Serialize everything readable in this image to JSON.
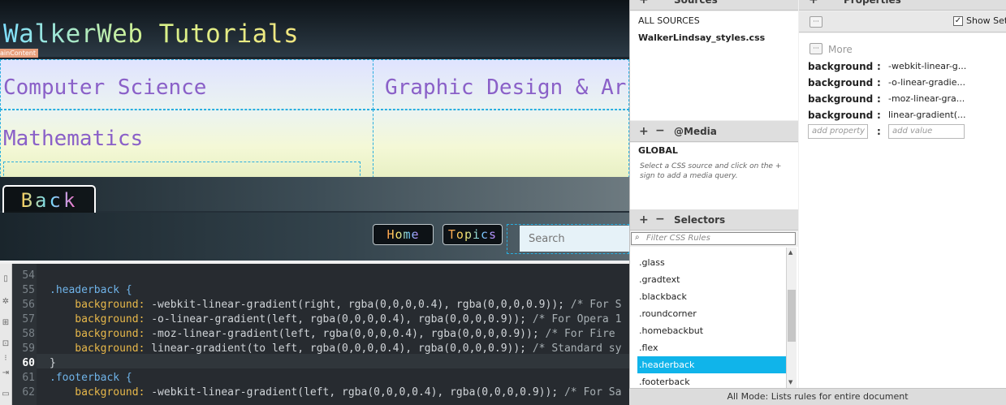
{
  "live": {
    "site_title": "WalkerWeb Tutorials",
    "main_tag": "ainContent",
    "subjects": [
      "Computer Science",
      "Graphic Design & Ar",
      "Mathematics"
    ],
    "back_label": "Back",
    "home_label": "Home",
    "topics_label": "Topics",
    "search_placeholder": "Search"
  },
  "code": {
    "line_numbers": [
      "54",
      "55",
      "56",
      "57",
      "58",
      "59",
      "60",
      "61",
      "62"
    ],
    "active_line": "60",
    "l55_selector": ".headerback {",
    "l56_prop": "    background:",
    "l56_val": " -webkit-linear-gradient(right, rgba(0,0,0,0.4), rgba(0,0,0,0.9)); ",
    "l56_cmt": "/* For S",
    "l57_prop": "    background:",
    "l57_val": " -o-linear-gradient(left, rgba(0,0,0,0.4), rgba(0,0,0,0.9)); ",
    "l57_cmt": "/* For Opera 1",
    "l58_prop": "    background:",
    "l58_val": " -moz-linear-gradient(left, rgba(0,0,0,0.4), rgba(0,0,0,0.9)); ",
    "l58_cmt": "/* For Fire",
    "l59_prop": "    background:",
    "l59_val": " linear-gradient(to left, rgba(0,0,0,0.4), rgba(0,0,0,0.9)); ",
    "l59_cmt": "/* Standard sy",
    "l60_text": "}",
    "l61_selector": ".footerback {",
    "l62_prop": "    background:",
    "l62_val": " -webkit-linear-gradient(left, rgba(0,0,0,0.4), rgba(0,0,0,0.9)); ",
    "l62_cmt": "/* For Sa"
  },
  "sources": {
    "title": "Sources",
    "all_label": "ALL SOURCES",
    "file": "WalkerLindsay_styles.css"
  },
  "media": {
    "title": "@Media",
    "global_label": "GLOBAL",
    "hint": "Select a CSS source and click on the + sign to add a media query."
  },
  "selectors": {
    "title": "Selectors",
    "filter_placeholder": "Filter CSS Rules",
    "items": [
      ".glass",
      ".gradtext",
      ".blackback",
      ".roundcorner",
      ".homebackbut",
      ".flex",
      ".headerback",
      ".footerback"
    ],
    "selected_index": 6
  },
  "properties": {
    "title": "Properties",
    "show_set_label": "Show Set",
    "more_label": "More",
    "rows": [
      {
        "name": "background",
        "value": "-webkit-linear-g..."
      },
      {
        "name": "background",
        "value": "-o-linear-gradie..."
      },
      {
        "name": "background",
        "value": "-moz-linear-gra..."
      },
      {
        "name": "background",
        "value": "linear-gradient(..."
      }
    ],
    "add_property_placeholder": "add property",
    "add_value_placeholder": "add value"
  },
  "status_bar": "All Mode: Lists rules for entire document",
  "colors": {
    "selection": "#10b4ea",
    "code_bg": "#272b30",
    "subject_text": "#8a60c8"
  }
}
